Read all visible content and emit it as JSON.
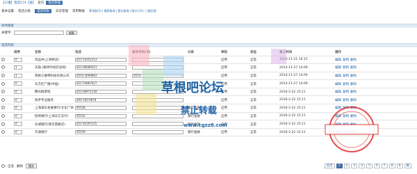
{
  "breadcrumb": {
    "left": "【三维】电话114【查】",
    "mid": "首页",
    "current": "电话管理"
  },
  "menu": {
    "items": [
      "基本设置",
      "电话分类",
      "电话列表",
      "日志管理",
      "常用数据"
    ],
    "active_index": 2,
    "extra": "等导航(3) | 搜索查询 | 登记查询 | 统计114 | 三级页面"
  },
  "search_section": {
    "title": "条件搜索",
    "label": "关键字:",
    "value": "",
    "button": "搜索"
  },
  "list_section": {
    "title": "电话列表"
  },
  "table": {
    "headers": [
      "",
      "排序",
      "名称",
      "电话",
      "查询号码(号)",
      "分类",
      "审核",
      "状态",
      "录入时间",
      "操作"
    ],
    "rows": [
      {
        "sort": "0",
        "name": "货运共(上海物流)",
        "phone": "021-54352313",
        "qno": "",
        "cat": "",
        "audit": "启用",
        "status": "正常",
        "time": "2014-11-21 16:15",
        "ops": [
          "编辑",
          "复制",
          "删除"
        ]
      },
      {
        "sort": "1",
        "name": "天猫-(服饰时尚店总经)",
        "phone": "021-66689521",
        "qno": "",
        "cat": "",
        "audit": "启用",
        "status": "正常",
        "time": "2014-11-27 14:09",
        "ops": [
          "编辑",
          "复制",
          "删除"
        ]
      },
      {
        "sort": "1",
        "name": "草根三维特科技有限公司",
        "phone": "0554-3699863",
        "qno": "0554-...",
        "cat": "",
        "audit": "启用",
        "status": "正常",
        "time": "2014-11-27 14:09",
        "ops": [
          "编辑",
          "复制",
          "删除"
        ]
      },
      {
        "sort": "0",
        "name": "东方红广播(中国)",
        "phone": "021-54887627",
        "qno": "",
        "cat": "",
        "audit": "启用",
        "status": "正常",
        "time": "2014-11-27 14:09",
        "ops": [
          "编辑",
          "复制",
          "删除"
        ]
      },
      {
        "sort": "0",
        "name": "腾讯微游戏",
        "phone": "021-66971118",
        "qno": "",
        "cat": "",
        "audit": "启用",
        "status": "正常",
        "time": "2016-2-22 15:11",
        "ops": [
          "编辑",
          "复制",
          "删除"
        ]
      },
      {
        "sort": "0",
        "name": "快手专业服务",
        "phone": "400-100-9878",
        "qno": "",
        "cat": "",
        "audit": "启用",
        "status": "正常",
        "time": "2016-2-22 15:11",
        "ops": [
          "编辑",
          "复制",
          "删除"
        ]
      },
      {
        "sort": "0",
        "name": "上海浦东发展银行(文化广场分行)",
        "phone": "95528",
        "qno": "",
        "cat": "银行金融",
        "audit": "启用",
        "status": "正常",
        "time": "2016-2-22 15:11",
        "ops": [
          "编辑",
          "复制",
          "删除"
        ]
      },
      {
        "sort": "0",
        "name": "招商银行(上海东方支行)",
        "phone": "95555",
        "qno": "",
        "cat": "银行金融",
        "audit": "启用",
        "status": "正常",
        "time": "2016-2-22 15:11",
        "ops": [
          "编辑",
          "复制",
          "删除"
        ]
      },
      {
        "sort": "0",
        "name": "乐诸银行(南京西路店)",
        "phone": "021-92397225",
        "qno": "",
        "cat": "银行金融",
        "audit": "启用",
        "status": "正常",
        "time": "2016-2-22 15:11",
        "ops": [
          "编辑",
          "复制",
          "删除"
        ]
      },
      {
        "sort": "0",
        "name": "交通银行",
        "phone": "95559",
        "qno": "",
        "cat": "银行金融",
        "audit": "启用",
        "status": "正常",
        "time": "2016-2-22 15:11",
        "ops": [
          "编辑",
          "复制",
          "删除"
        ]
      }
    ]
  },
  "bottom": {
    "select_all": "全选",
    "delete_label": "删除",
    "button": "提交"
  },
  "pager": {
    "pages": [
      "首页",
      "1",
      "2",
      "3",
      "4",
      "5",
      "6",
      "7",
      "8",
      "9",
      "尾"
    ],
    "current": "1"
  },
  "watermark": {
    "line1": "草根吧论坛",
    "line2": "禁止转载",
    "line3": "www.cgzz8.com"
  },
  "colors": {
    "accent": "#3d6fa8",
    "link": "#2468a8",
    "section_bg": "#e2ebf4"
  }
}
